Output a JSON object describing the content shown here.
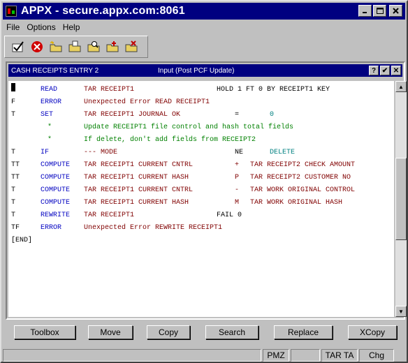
{
  "window": {
    "title": "APPX - secure.appx.com:8061"
  },
  "menu": [
    "File",
    "Options",
    "Help"
  ],
  "toolbar_icons": [
    "check-icon",
    "stop-icon",
    "folder-new-icon",
    "folder-open-icon",
    "folder-search-icon",
    "folder-add-icon",
    "folder-delete-icon"
  ],
  "panel": {
    "left_title": "CASH RECEIPTS ENTRY 2",
    "center_title": "Input  (Post PCF Update)",
    "help": "?",
    "ok": "✔",
    "close": "✕"
  },
  "lines": [
    {
      "flag": "",
      "verb": "READ",
      "text": "TAR RECEIPT1",
      "extra": "HOLD 1 FT 0 BY RECEIPT1 KEY"
    },
    {
      "flag": "F",
      "verb": "ERROR",
      "text": "Unexpected Error READ RECEIPT1",
      "extra": ""
    },
    {
      "flag": "T",
      "verb": "SET",
      "text": "TAR RECEIPT1 JOURNAL OK",
      "op": "=",
      "rest": "0"
    },
    {
      "flag": "",
      "verb": "*",
      "comment": "Update RECEIPT1 file control and hash total fields"
    },
    {
      "flag": "",
      "verb": "*",
      "comment": "If delete, don't add fields from RECEIPT2"
    },
    {
      "flag": "T",
      "verb": "IF",
      "text": "--- MODE",
      "op": "NE",
      "rest": "DELETE"
    },
    {
      "flag": "TT",
      "verb": "COMPUTE",
      "text": "TAR RECEIPT1 CURRENT CNTRL",
      "op": "+",
      "rest": "TAR RECEIPT2 CHECK AMOUNT"
    },
    {
      "flag": "TT",
      "verb": "COMPUTE",
      "text": "TAR RECEIPT1 CURRENT HASH",
      "op": "P",
      "rest": "TAR RECEIPT2 CUSTOMER NO"
    },
    {
      "flag": "T",
      "verb": "COMPUTE",
      "text": "TAR RECEIPT1 CURRENT CNTRL",
      "op": "-",
      "rest": "TAR WORK ORIGINAL CONTROL"
    },
    {
      "flag": "T",
      "verb": "COMPUTE",
      "text": "TAR RECEIPT1 CURRENT HASH",
      "op": "M",
      "rest": "TAR WORK ORIGINAL HASH"
    },
    {
      "flag": "T",
      "verb": "REWRITE",
      "text": "TAR RECEIPT1",
      "extra": "FAIL 0"
    },
    {
      "flag": "TF",
      "verb": "ERROR",
      "text": "Unexpected Error REWRITE RECEIPT1",
      "extra": ""
    },
    {
      "flag": "[END]",
      "verb": "",
      "text": "",
      "extra": ""
    }
  ],
  "buttons": [
    "Toolbox",
    "Move",
    "Copy",
    "Search",
    "Replace",
    "XCopy"
  ],
  "status": [
    "",
    "PMZ",
    "",
    "TAR TA",
    "Chg"
  ]
}
